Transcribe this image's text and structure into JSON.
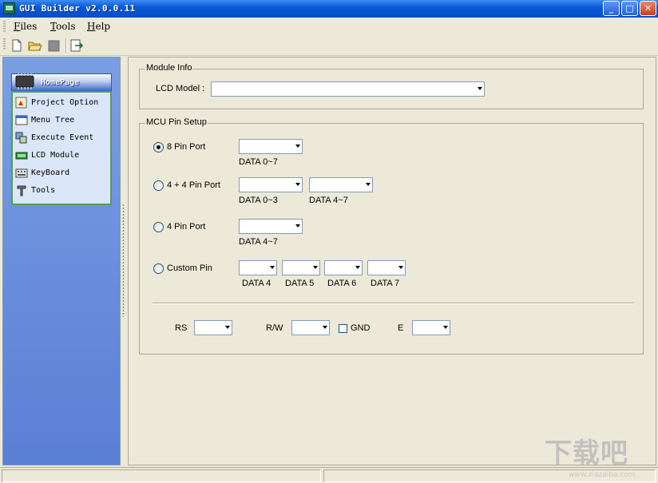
{
  "window": {
    "title": "GUI Builder v2.0.0.11",
    "icon": "app-chip-icon",
    "controls": {
      "minimize": "_",
      "maximize": "□",
      "close": "✕"
    }
  },
  "menu": {
    "items": [
      {
        "label": "Files",
        "accel": "F",
        "rest": "iles"
      },
      {
        "label": "Tools",
        "accel": "T",
        "rest": "ools"
      },
      {
        "label": "Help",
        "accel": "H",
        "rest": "elp"
      }
    ]
  },
  "toolbar": {
    "buttons": [
      "new-file-icon",
      "open-folder-icon",
      "stop-icon",
      "exit-icon"
    ]
  },
  "sidebar": {
    "header": "HomePage",
    "items": [
      {
        "label": "Project Option",
        "icon": "project-option-icon"
      },
      {
        "label": "Menu Tree",
        "icon": "menu-tree-icon"
      },
      {
        "label": "Execute Event",
        "icon": "execute-event-icon"
      },
      {
        "label": "LCD Module",
        "icon": "lcd-module-icon"
      },
      {
        "label": "KeyBoard",
        "icon": "keyboard-icon"
      },
      {
        "label": "Tools",
        "icon": "tools-icon"
      }
    ]
  },
  "module_info": {
    "legend": "Module Info",
    "lcd_model_label": "LCD Model :",
    "lcd_model_value": ""
  },
  "mcu_pin_setup": {
    "legend": "MCU Pin Setup",
    "options": [
      {
        "label": "8 Pin Port",
        "selected": true,
        "ports": [
          "DATA 0~7"
        ]
      },
      {
        "label": "4 + 4 Pin Port",
        "selected": false,
        "ports": [
          "DATA 0~3",
          "DATA 4~7"
        ]
      },
      {
        "label": "4 Pin Port",
        "selected": false,
        "ports": [
          "DATA 4~7"
        ]
      },
      {
        "label": "Custom Pin",
        "selected": false,
        "ports": [
          "DATA 4",
          "DATA 5",
          "DATA 6",
          "DATA 7"
        ]
      }
    ],
    "control": {
      "rs_label": "RS",
      "rw_label": "R/W",
      "gnd_label": "GND",
      "gnd_checked": false,
      "e_label": "E"
    }
  },
  "watermark": {
    "text": "下载吧",
    "sub": "www.xiazaiba.com"
  }
}
